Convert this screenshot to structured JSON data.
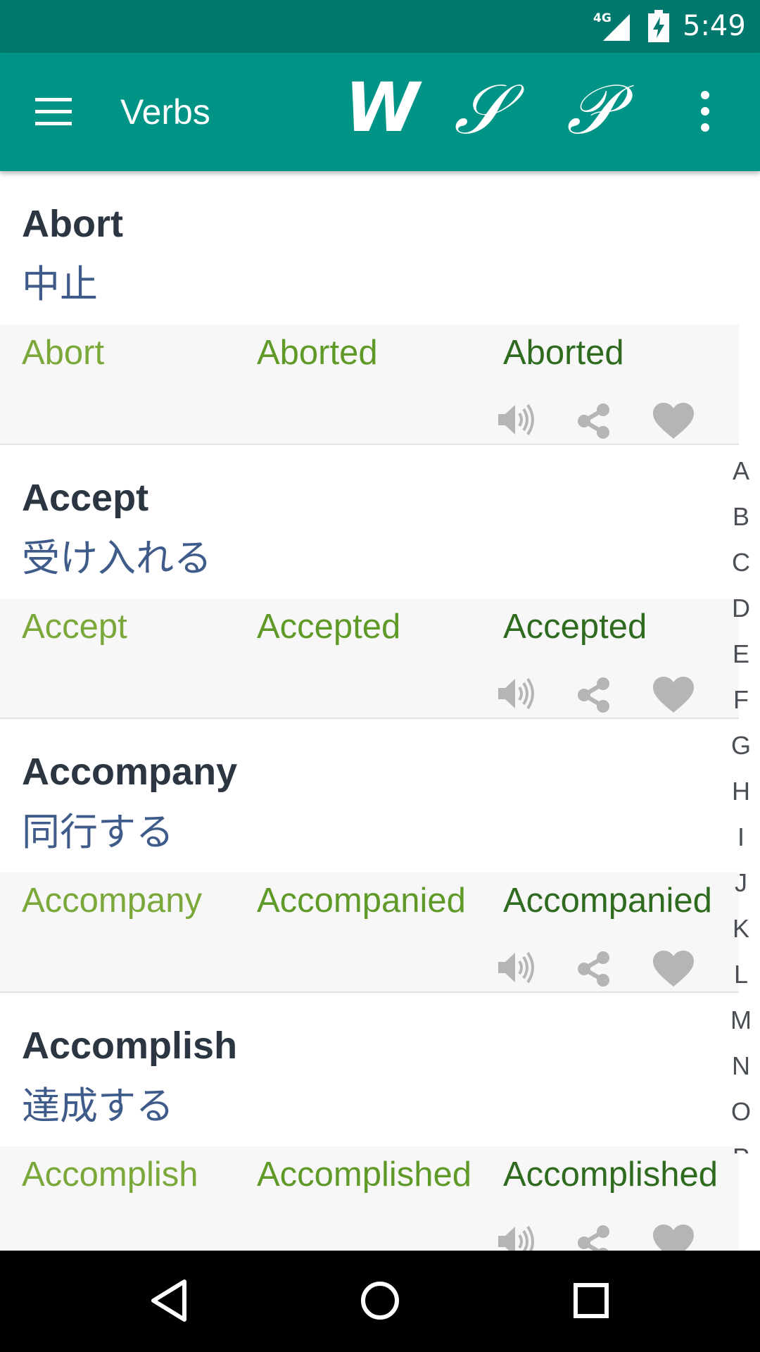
{
  "status_bar": {
    "network": "4G",
    "time": "5:49",
    "icons": [
      "signal-icon",
      "battery-charging-icon"
    ]
  },
  "app_bar": {
    "title": "Verbs",
    "mode_buttons": [
      "W",
      "𝒮",
      "𝒫"
    ],
    "icons": [
      "menu-icon",
      "overflow-menu-icon"
    ]
  },
  "verbs": [
    {
      "word": "Abort",
      "translation": "中止",
      "forms": [
        "Abort",
        "Aborted",
        "Aborted"
      ]
    },
    {
      "word": "Accept",
      "translation": "受け入れる",
      "forms": [
        "Accept",
        "Accepted",
        "Accepted"
      ]
    },
    {
      "word": "Accompany",
      "translation": "同行する",
      "forms": [
        "Accompany",
        "Accompanied",
        "Accompanied"
      ]
    },
    {
      "word": "Accomplish",
      "translation": "達成する",
      "forms": [
        "Accomplish",
        "Accomplished",
        "Accomplished"
      ]
    }
  ],
  "card_actions": [
    "speaker-icon",
    "share-icon",
    "heart-icon"
  ],
  "alphabet": [
    "A",
    "B",
    "C",
    "D",
    "E",
    "F",
    "G",
    "H",
    "I",
    "J",
    "K",
    "L",
    "M",
    "N",
    "O",
    "P"
  ],
  "colors": {
    "status_bar": "#00786d",
    "app_bar": "#009486",
    "word": "#2b3642",
    "translation": "#3f5b8a",
    "forms": "#6b9c2a",
    "icon_gray": "#b5b5b5"
  },
  "nav_bar": {
    "icons": [
      "back-icon",
      "home-icon",
      "recents-icon"
    ]
  }
}
